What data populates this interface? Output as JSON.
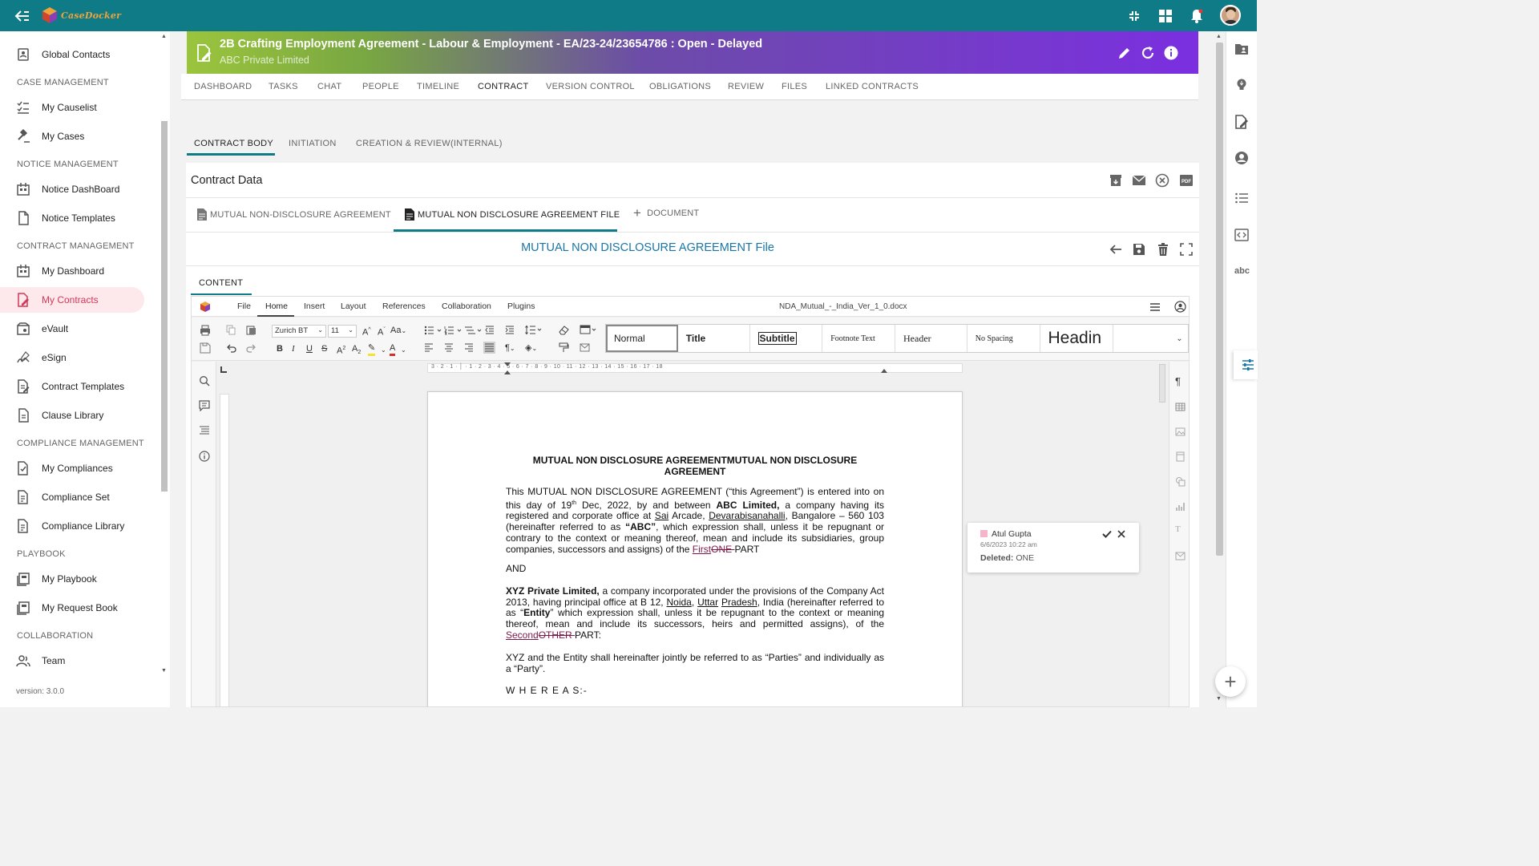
{
  "app": {
    "brand": "CaseDocker"
  },
  "sidebar": {
    "items": [
      {
        "label": "Global Contacts",
        "icon": "contact-book-icon"
      },
      {
        "label": "My Causelist",
        "icon": "list-check-icon"
      },
      {
        "label": "My Cases",
        "icon": "gavel-icon"
      },
      {
        "label": "Notice DashBoard",
        "icon": "dashboard-building-icon"
      },
      {
        "label": "Notice Templates",
        "icon": "document-icon"
      },
      {
        "label": "My Dashboard",
        "icon": "dashboard-building-icon"
      },
      {
        "label": "My Contracts",
        "icon": "contract-edit-icon"
      },
      {
        "label": "eVault",
        "icon": "vault-icon"
      },
      {
        "label": "eSign",
        "icon": "signature-icon"
      },
      {
        "label": "Contract Templates",
        "icon": "contract-edit-icon"
      },
      {
        "label": "Clause Library",
        "icon": "document-icon"
      },
      {
        "label": "My Compliances",
        "icon": "compliance-icon"
      },
      {
        "label": "Compliance Set",
        "icon": "compliance-icon"
      },
      {
        "label": "Compliance Library",
        "icon": "compliance-icon"
      },
      {
        "label": "My Playbook",
        "icon": "playbook-icon"
      },
      {
        "label": "My Request Book",
        "icon": "playbook-icon"
      },
      {
        "label": "Team",
        "icon": "team-icon"
      }
    ],
    "sections": [
      "CASE MANAGEMENT",
      "NOTICE MANAGEMENT",
      "CONTRACT MANAGEMENT",
      "COMPLIANCE MANAGEMENT",
      "PLAYBOOK",
      "COLLABORATION"
    ],
    "version": "version: 3.0.0"
  },
  "header": {
    "title": "2B Crafting Employment Agreement - Labour & Employment - EA/23-24/23654786 : Open - Delayed",
    "subtitle": "ABC Private Limited"
  },
  "tabs": {
    "main": [
      "DASHBOARD",
      "TASKS",
      "CHAT",
      "PEOPLE",
      "TIMELINE",
      "CONTRACT",
      "VERSION CONTROL",
      "OBLIGATIONS",
      "REVIEW",
      "FILES",
      "LINKED CONTRACTS"
    ],
    "sub": [
      "CONTRACT BODY",
      "INITIATION",
      "CREATION & REVIEW(INTERNAL)"
    ]
  },
  "contract_card": {
    "title": "Contract Data",
    "doc_tabs": [
      "MUTUAL NON-DISCLOSURE AGREEMENT",
      "MUTUAL NON DISCLOSURE AGREEMENT FILE",
      "DOCUMENT"
    ],
    "file_title": "MUTUAL NON DISCLOSURE AGREEMENT File",
    "content_tab": "CONTENT"
  },
  "editor": {
    "menu": [
      "File",
      "Home",
      "Insert",
      "Layout",
      "References",
      "Collaboration",
      "Plugins"
    ],
    "filename": "NDA_Mutual_-_India_Ver_1_0.docx",
    "font_name": "Zurich BT",
    "font_size": "11",
    "styles": [
      "Normal",
      "Title",
      "Subtitle",
      "Footnote Text",
      "Header",
      "No Spacing",
      "Headin"
    ],
    "ruler_labels": "3 · 2 · 1 · │ · 1 · 2 · 3 · 4 · 5 · 6 · 7 · 8 · 9 · 10 · 11 · 12 · 13 · 14 · 15 · 16 · 17 · 18"
  },
  "document": {
    "title": "MUTUAL NON DISCLOSURE AGREEMENTMUTUAL NON DISCLOSURE AGREEMENT",
    "p1_a": "This MUTUAL NON DISCLOSURE AGREEMENT (“this Agreement”) is entered into on this day of 19",
    "p1_sup": "th",
    "p1_b": " Dec, 2022, by and between ",
    "p1_abc": "ABC Limited,",
    "p1_c": " a company having its registered and corporate office at ",
    "p1_sai": "Sai",
    "p1_d": " Arcade, ",
    "p1_dev": "Devarabisanahalli",
    "p1_e": ", Bangalore – 560 103 (hereinafter referred to as ",
    "p1_abcq": "“ABC”",
    "p1_f": ", which expression shall, unless it be repugnant or contrary to the context or meaning thereof, mean and include its subsidiaries, group companies, successors and assigns) of the ",
    "p1_ins": "First",
    "p1_del": "ONE ",
    "p1_g": "PART",
    "and": "AND",
    "p2_xyz": "XYZ Private Limited,",
    "p2_a": " a company incorporated under the provisions of the Company Act 2013, having principal office at B 12, ",
    "p2_noida": "Noida",
    "p2_b": ", ",
    "p2_uttar": "Uttar",
    "p2_c": " ",
    "p2_pradesh": "Pradesh",
    "p2_d": ", India (hereinafter referred to as “",
    "p2_entity": "Entity",
    "p2_e": "” which expression shall, unless it be repugnant to the context or meaning thereof, mean and include its successors, heirs and permitted assigns), of the ",
    "p2_ins": "Second",
    "p2_del": "OTHER ",
    "p2_f": "PART:",
    "p3": "XYZ and the Entity shall hereinafter jointly be referred to as “Parties” and individually as a “Party”.",
    "whereas": "W H E R E A S:-"
  },
  "comment": {
    "author": "Atul Gupta",
    "time": "6/6/2023 10:22 am",
    "label": "Deleted:",
    "value": " ONE"
  },
  "colors": {
    "topbar": "#0f7b87",
    "accent": "#0f7b87",
    "active_nav": "#d4385a",
    "file_title": "#1976a8"
  }
}
